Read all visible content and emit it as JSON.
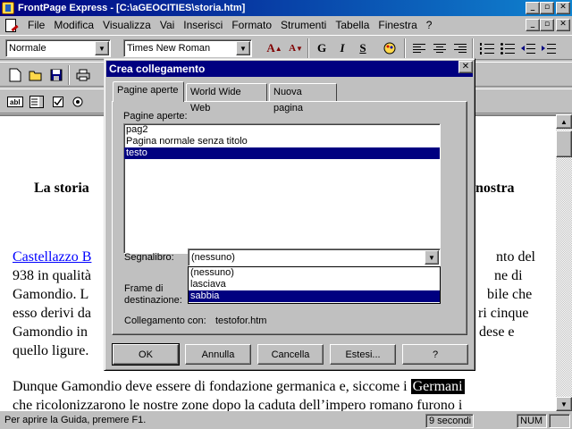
{
  "window": {
    "title": "FrontPage Express - [C:\\aGEOCITIES\\storia.htm]"
  },
  "menu": [
    "File",
    "Modifica",
    "Visualizza",
    "Vai",
    "Inserisci",
    "Formato",
    "Strumenti",
    "Tabella",
    "Finestra",
    "?"
  ],
  "toolbar": {
    "style_value": "Normale",
    "font_value": "Times New Roman",
    "bold": "G",
    "italic": "I",
    "underline": "S"
  },
  "document": {
    "title_left": "La storia",
    "title_right": "nostra",
    "lines_left": [
      {
        "text": "Castellazzo B",
        "link": true
      },
      {
        "text": "938 in qualità"
      },
      {
        "text": "Gamondio. L"
      },
      {
        "text": "esso derivi da"
      },
      {
        "text": "Gamondio in"
      },
      {
        "text": "quello ligure."
      }
    ],
    "lines_right": [
      "nto del",
      "ne di",
      "bile che",
      "ri cinque",
      "dese e"
    ],
    "para2_line1": "Dunque Gamondio deve essere di fondazione germanica e, siccome i",
    "para2_highlight": "Germani",
    "para2_line2": "che ricolonizzarono le nostre zone dopo la caduta dell’impero romano furono i"
  },
  "dialog": {
    "title": "Crea collegamento",
    "tabs": [
      "Pagine aperte",
      "World Wide Web",
      "Nuova pagina"
    ],
    "pages_label": "Pagine aperte:",
    "pages": [
      {
        "label": "pag2",
        "selected": false
      },
      {
        "label": "Pagina normale senza titolo",
        "selected": false
      },
      {
        "label": "testo",
        "selected": true
      }
    ],
    "bookmark_label": "Segnalibro:",
    "bookmark_value": "(nessuno)",
    "bookmark_options": [
      {
        "label": "(nessuno)",
        "selected": false
      },
      {
        "label": "lasciava",
        "selected": false
      },
      {
        "label": "sabbia",
        "selected": true
      }
    ],
    "frame_label_1": "Frame di",
    "frame_label_2": "destinazione:",
    "link_label": "Collegamento con:",
    "link_value": "testofor.htm",
    "buttons": [
      "OK",
      "Annulla",
      "Cancella",
      "Estesi...",
      "?"
    ]
  },
  "status": {
    "help": "Per aprire la Guida, premere F1.",
    "time": "9 secondi",
    "num": "NUM"
  },
  "colors": {
    "title_bar": "#000080",
    "selection": "#000080",
    "link": "#0000ff",
    "face": "#c0c0c0"
  }
}
